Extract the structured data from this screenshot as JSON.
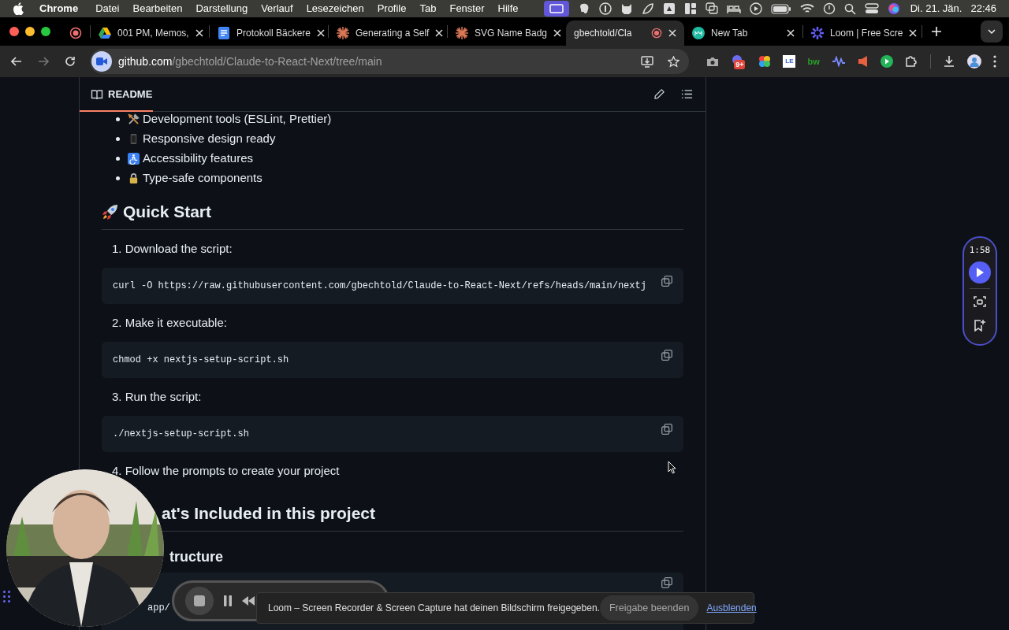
{
  "menu_bar": {
    "app": "Chrome",
    "menus": [
      "Datei",
      "Bearbeiten",
      "Darstellung",
      "Verlauf",
      "Lesezeichen",
      "Profile",
      "Tab",
      "Fenster",
      "Hilfe"
    ],
    "date": "Di. 21. Jän.",
    "time": "22:46"
  },
  "tabs": [
    {
      "selected": false,
      "recording": true
    },
    {
      "title": "001 PM, Memos,",
      "selected": false,
      "recording": false
    },
    {
      "title": "Protokoll Bäckere",
      "selected": false,
      "recording": false
    },
    {
      "title": "Generating a Self",
      "selected": false,
      "recording": false
    },
    {
      "title": "SVG Name Badg",
      "selected": false,
      "recording": false
    },
    {
      "title": "gbechtold/Cla",
      "selected": true,
      "recording": true
    },
    {
      "title": "New Tab",
      "selected": false,
      "recording": false
    },
    {
      "title": "Loom | Free Scre",
      "selected": false,
      "recording": false
    }
  ],
  "address_bar": {
    "host": "github.com",
    "path": "/gbechtold/Claude-to-React-Next/tree/main"
  },
  "extensions": {
    "badge": "9+",
    "le_label": "LE",
    "bw_label": "bw"
  },
  "readme": {
    "title": "README",
    "blocks": [
      {
        "kind": "bullets",
        "items": [
          "Development tools (ESLint, Prettier)",
          "Responsive design ready",
          "Accessibility features",
          "Type-safe components"
        ]
      },
      {
        "kind": "h2",
        "text": "Quick Start"
      },
      {
        "kind": "step",
        "text": "1. Download the script:"
      },
      {
        "kind": "code",
        "text": "curl -O https://raw.githubusercontent.com/gbechtold/Claude-to-React-Next/refs/heads/main/nextj"
      },
      {
        "kind": "step",
        "text": "2. Make it executable:"
      },
      {
        "kind": "code",
        "text": "chmod +x nextjs-setup-script.sh"
      },
      {
        "kind": "step",
        "text": "3. Run the script:"
      },
      {
        "kind": "code",
        "text": "./nextjs-setup-script.sh"
      },
      {
        "kind": "step",
        "text": "4. Follow the prompts to create your project"
      },
      {
        "kind": "h2",
        "text": "at's Included in this project"
      },
      {
        "kind": "h3",
        "text": "tructure"
      },
      {
        "kind": "code",
        "text": "app/"
      }
    ]
  },
  "recorder_widget": {
    "timer": "1:58"
  },
  "share_notice": {
    "text": "Loom – Screen Recorder & Screen Capture hat deinen Bildschirm freigegeben.",
    "stop_button": "Freigabe beenden",
    "hide_link": "Ausblenden"
  }
}
